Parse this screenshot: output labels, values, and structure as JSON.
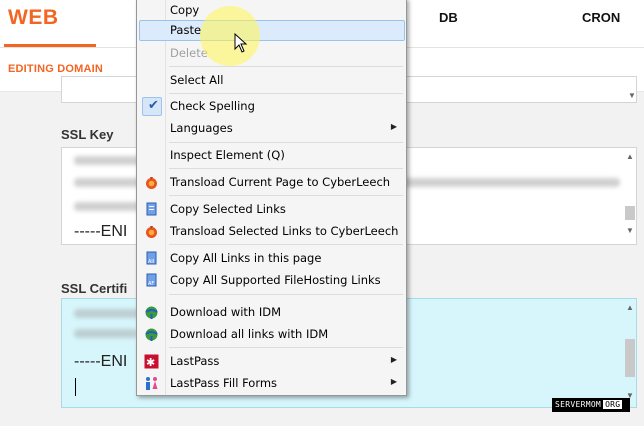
{
  "nav": {
    "web": "WEB",
    "db": "DB",
    "cron": "CRON"
  },
  "subnav": {
    "editing_domain": "EDITING DOMAIN"
  },
  "form": {
    "ssl_key_label": "SSL Key",
    "ssl_key_tail": "-----ENI",
    "ssl_cert_label": "SSL Certifi",
    "ssl_cert_tail": "-----ENI"
  },
  "context_menu": {
    "items": [
      {
        "label": "Copy",
        "icon": ""
      },
      {
        "label": "Paste",
        "icon": "",
        "hovered": true
      },
      {
        "label": "Delete",
        "icon": "",
        "disabled": true
      },
      {
        "label": "Select All",
        "icon": ""
      },
      {
        "label": "Check Spelling",
        "icon": "checkmark-icon",
        "checked": true
      },
      {
        "label": "Languages",
        "icon": "",
        "submenu": true
      },
      {
        "label": "Inspect Element (Q)",
        "icon": ""
      },
      {
        "label": "Transload Current Page to CyberLeech",
        "icon": "cyberleech-icon"
      },
      {
        "label": "Copy Selected Links",
        "icon": "copy-links-icon"
      },
      {
        "label": "Transload Selected Links to CyberLeech",
        "icon": "cyberleech-icon"
      },
      {
        "label": "Copy All Links in this page",
        "icon": "all-links-icon"
      },
      {
        "label": "Copy All Supported FileHosting Links",
        "icon": "filehosting-icon"
      },
      {
        "label": "Download with IDM",
        "icon": "idm-icon"
      },
      {
        "label": "Download all links with IDM",
        "icon": "idm-icon"
      },
      {
        "label": "LastPass",
        "icon": "lastpass-icon",
        "submenu": true
      },
      {
        "label": "LastPass Fill Forms",
        "icon": "lastpass-fill-icon",
        "submenu": true
      }
    ]
  },
  "watermark": {
    "text": "SERVERMOM",
    "suffix": "ORG"
  },
  "colors": {
    "accent": "#f26522",
    "cert_bg": "#d6f6fb",
    "menu_hover": "#dcebfb"
  }
}
